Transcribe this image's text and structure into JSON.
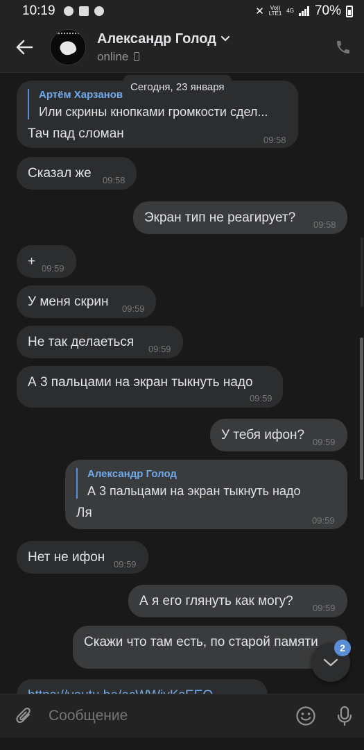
{
  "status_bar": {
    "time": "10:19",
    "network_top": "Vo))",
    "network_bottom": "LTE1",
    "net_type": "4G",
    "battery": "70%"
  },
  "header": {
    "contact_name": "Александр Голод",
    "status": "online",
    "icons": [
      "back-arrow-icon",
      "chevron-down-icon",
      "phone-device-icon",
      "call-icon"
    ]
  },
  "date_separator": "Сегодня, 23 января",
  "messages": [
    {
      "direction": "in",
      "reply_author": "Артём Харзанов",
      "reply_text": "Или скрины кнопками громкости сдел...",
      "text": "Тач пад сломан",
      "time": "09:58"
    },
    {
      "direction": "in",
      "text": "Сказал же",
      "time": "09:58"
    },
    {
      "direction": "out",
      "text": "Экран тип не реагирует?",
      "time": "09:58"
    },
    {
      "direction": "in",
      "text": "+",
      "time": "09:59"
    },
    {
      "direction": "in",
      "text": "У меня скрин",
      "time": "09:59"
    },
    {
      "direction": "in",
      "text": "Не так делаеться",
      "time": "09:59"
    },
    {
      "direction": "in",
      "text": "А 3 пальцами на экран тыкнуть надо",
      "time": "09:59"
    },
    {
      "direction": "out",
      "text": "У тебя ифон?",
      "time": "09:59"
    },
    {
      "direction": "out",
      "reply_author": "Александр Голод",
      "reply_text": "А 3 пальцами на экран тыкнуть надо",
      "text": "Ля",
      "time": "09:59"
    },
    {
      "direction": "in",
      "text": "Нет не ифон",
      "time": "09:59"
    },
    {
      "direction": "out",
      "text": "А я его глянуть как могу?",
      "time": "09:59"
    },
    {
      "direction": "out",
      "text": "Скажи что там есть, по старой памяти"
    },
    {
      "direction": "in",
      "text": "https://youtu.be/ecWWivKsEEQ"
    }
  ],
  "scroll_down": {
    "badge": "2"
  },
  "composer": {
    "placeholder": "Сообщение"
  },
  "colors": {
    "background": "#19191a",
    "bubble_in": "#2c2d2e",
    "bubble_out": "#3a3b3c",
    "accent": "#71aaeb"
  }
}
